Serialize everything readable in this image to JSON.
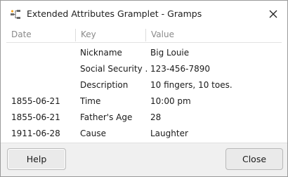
{
  "window": {
    "title": "Extended Attributes Gramplet - Gramps",
    "icon": "gramps-app-icon",
    "close_icon": "close-icon"
  },
  "table": {
    "headers": {
      "date": "Date",
      "key": "Key",
      "value": "Value"
    },
    "rows": [
      {
        "date": "",
        "key": "Nickname",
        "value": "Big Louie"
      },
      {
        "date": "",
        "key": "Social Security ...",
        "value": "123-456-7890"
      },
      {
        "date": "",
        "key": "Description",
        "value": "10 fingers, 10 toes."
      },
      {
        "date": "1855-06-21",
        "key": "Time",
        "value": "10:00 pm"
      },
      {
        "date": "1855-06-21",
        "key": "Father's Age",
        "value": "28"
      },
      {
        "date": "1911-06-28",
        "key": "Cause",
        "value": "Laughter"
      }
    ]
  },
  "buttons": {
    "help": "Help",
    "close": "Close"
  }
}
